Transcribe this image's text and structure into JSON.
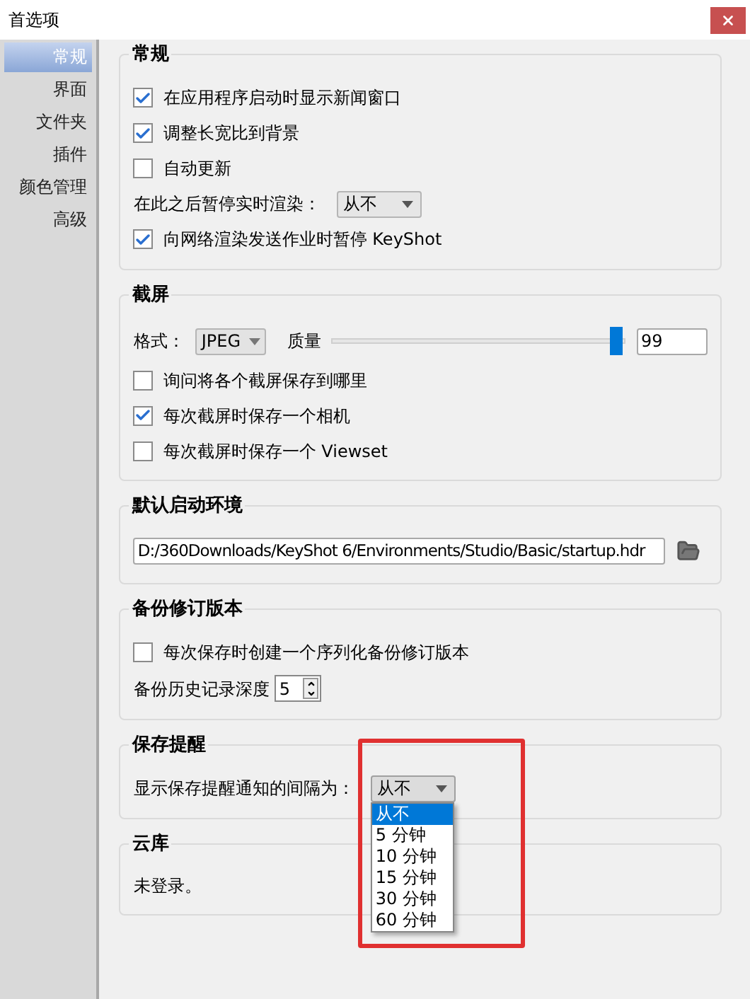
{
  "window": {
    "title": "首选项"
  },
  "sidebar": {
    "items": [
      {
        "label": "常规",
        "selected": true
      },
      {
        "label": "界面",
        "selected": false
      },
      {
        "label": "文件夹",
        "selected": false
      },
      {
        "label": "插件",
        "selected": false
      },
      {
        "label": "颜色管理",
        "selected": false
      },
      {
        "label": "高级",
        "selected": false
      }
    ]
  },
  "sections": [
    {
      "title": "常规",
      "rows": [
        {
          "kind": "checkbox",
          "label": "在应用程序启动时显示新闻窗口",
          "checked": true
        },
        {
          "kind": "checkbox",
          "label": "调整长宽比到背景",
          "checked": true
        },
        {
          "kind": "checkbox",
          "label": "自动更新",
          "checked": false
        },
        {
          "kind": "select",
          "label": "在此之后暂停实时渲染：",
          "value": "从不",
          "expanded": false
        },
        {
          "kind": "checkbox",
          "label": "向网络渲染发送作业时暂停 KeyShot",
          "checked": true
        }
      ]
    },
    {
      "title": "截屏",
      "rows": [
        {
          "kind": "format",
          "label": "格式：",
          "value": "JPEG",
          "quality_label": "质量",
          "level": 0.97,
          "quality": "99"
        },
        {
          "kind": "checkbox",
          "label": "询问将各个截屏保存到哪里",
          "checked": false
        },
        {
          "kind": "checkbox",
          "label": "每次截屏时保存一个相机",
          "checked": true
        },
        {
          "kind": "checkbox",
          "label": "每次截屏时保存一个 Viewset",
          "checked": false
        }
      ]
    },
    {
      "title": "默认启动环境",
      "rows": [
        {
          "kind": "path",
          "value": "D:/360Downloads/KeyShot 6/Environments/Studio/Basic/startup.hdr"
        }
      ]
    },
    {
      "title": "备份修订版本",
      "rows": [
        {
          "kind": "checkbox",
          "label": "每次保存时创建一个序列化备份修订版本",
          "checked": false
        },
        {
          "kind": "spinner",
          "label": "备份历史记录深度",
          "value": "5"
        }
      ]
    },
    {
      "title": "保存提醒",
      "rows": [
        {
          "kind": "select",
          "label": "显示保存提醒通知的间隔为：",
          "value": "从不",
          "expanded": true,
          "options": [
            {
              "label": "从不",
              "selected": true
            },
            {
              "label": "5 分钟",
              "selected": false
            },
            {
              "label": "10 分钟",
              "selected": false
            },
            {
              "label": "15 分钟",
              "selected": false
            },
            {
              "label": "30 分钟",
              "selected": false
            },
            {
              "label": "60 分钟",
              "selected": false
            }
          ]
        }
      ]
    },
    {
      "title": "云库",
      "rows": [
        {
          "kind": "text",
          "text": "未登录。"
        }
      ]
    }
  ]
}
